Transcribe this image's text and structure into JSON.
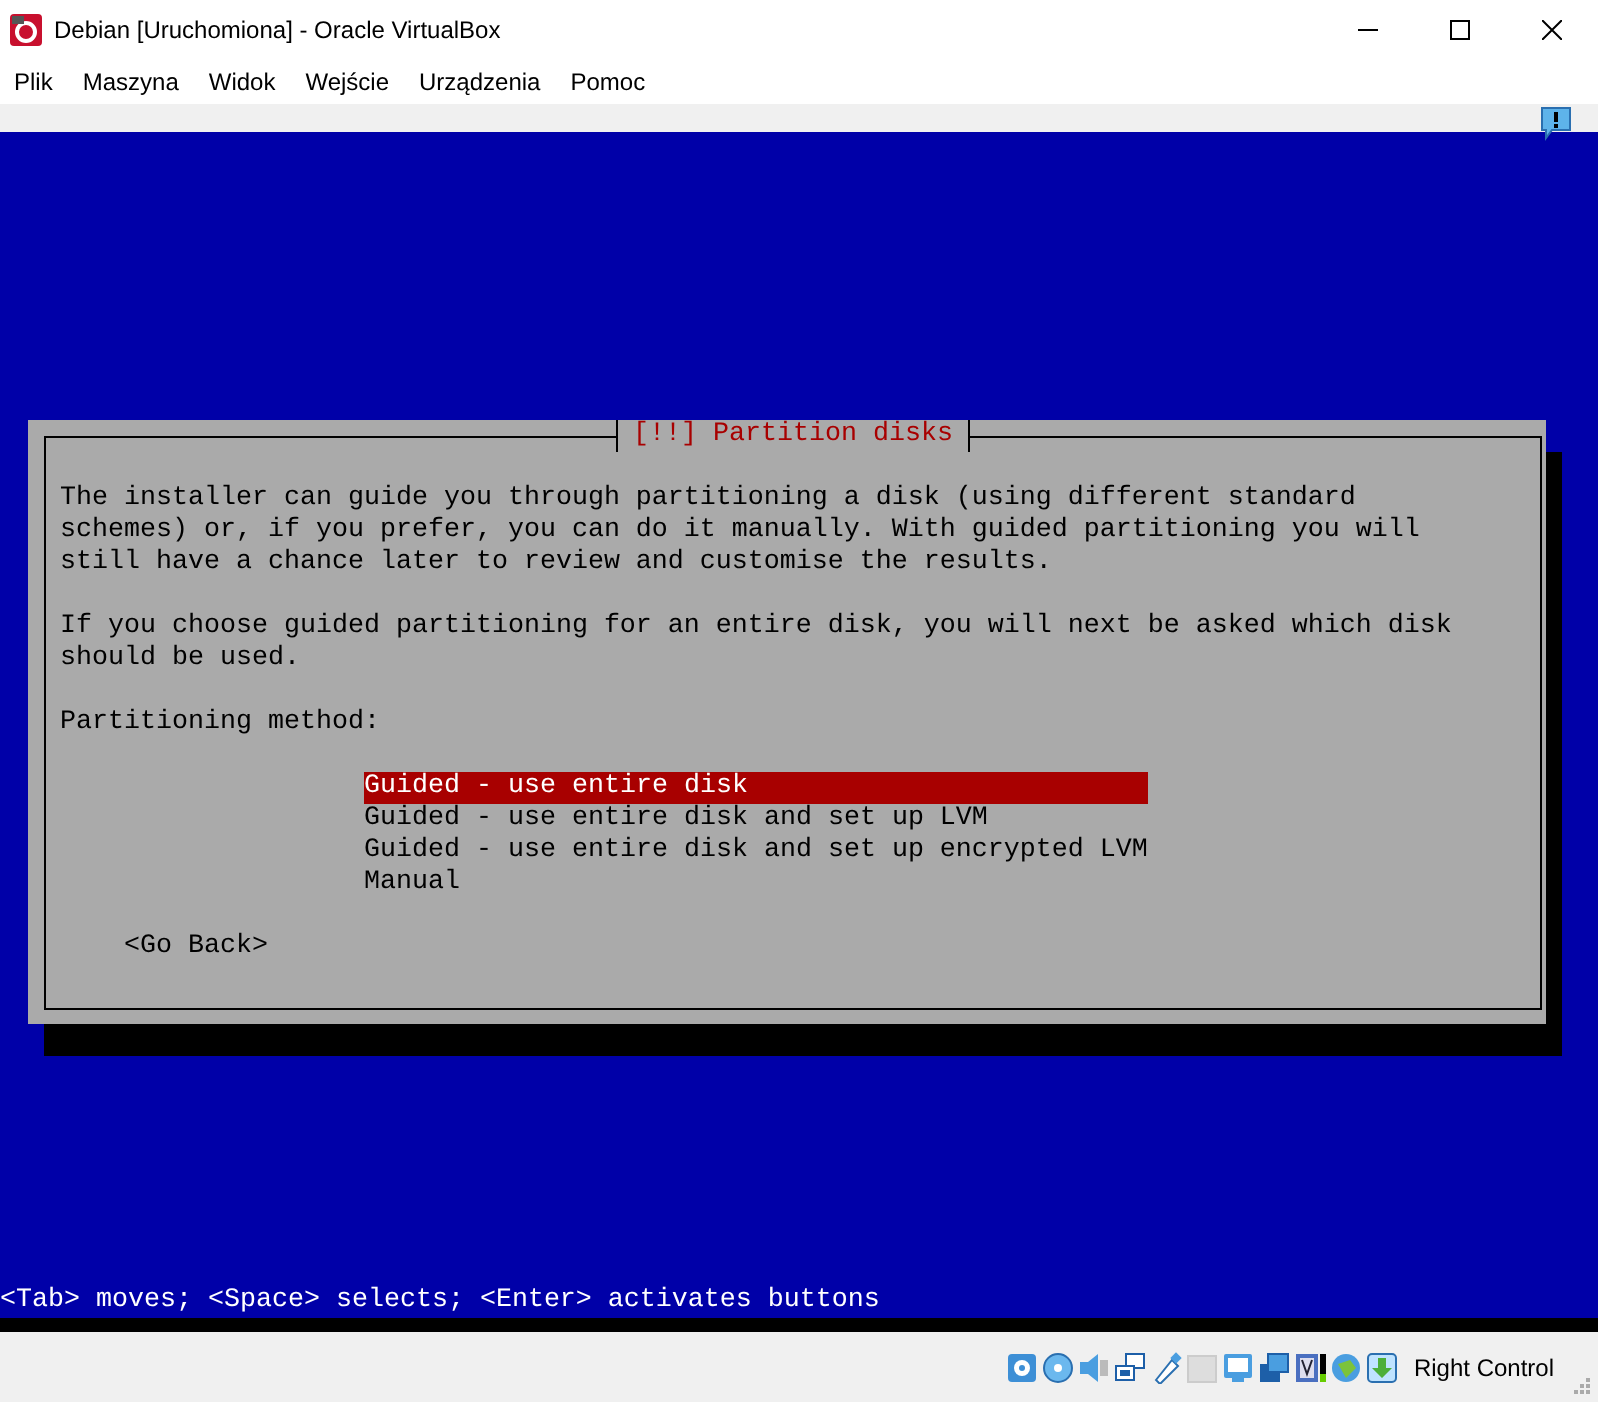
{
  "window": {
    "title": "Debian [Uruchomiona] - Oracle VirtualBox"
  },
  "menu": [
    "Plik",
    "Maszyna",
    "Widok",
    "Wejście",
    "Urządzenia",
    "Pomoc"
  ],
  "installer": {
    "title": "[!!] Partition disks",
    "paragraphs": [
      "The installer can guide you through partitioning a disk (using different standard schemes) or, if you prefer, you can do it manually. With guided partitioning you will still have a chance later to review and customise the results.",
      "If you choose guided partitioning for an entire disk, you will next be asked which disk should be used."
    ],
    "prompt": "Partitioning method:",
    "options": [
      {
        "label": "Guided - use entire disk",
        "selected": true
      },
      {
        "label": "Guided - use entire disk and set up LVM",
        "selected": false
      },
      {
        "label": "Guided - use entire disk and set up encrypted LVM",
        "selected": false
      },
      {
        "label": "Manual",
        "selected": false
      }
    ],
    "back_button": "<Go Back>"
  },
  "hint": "<Tab> moves; <Space> selects; <Enter> activates buttons",
  "status_bar": {
    "host_key": "Right Control"
  }
}
